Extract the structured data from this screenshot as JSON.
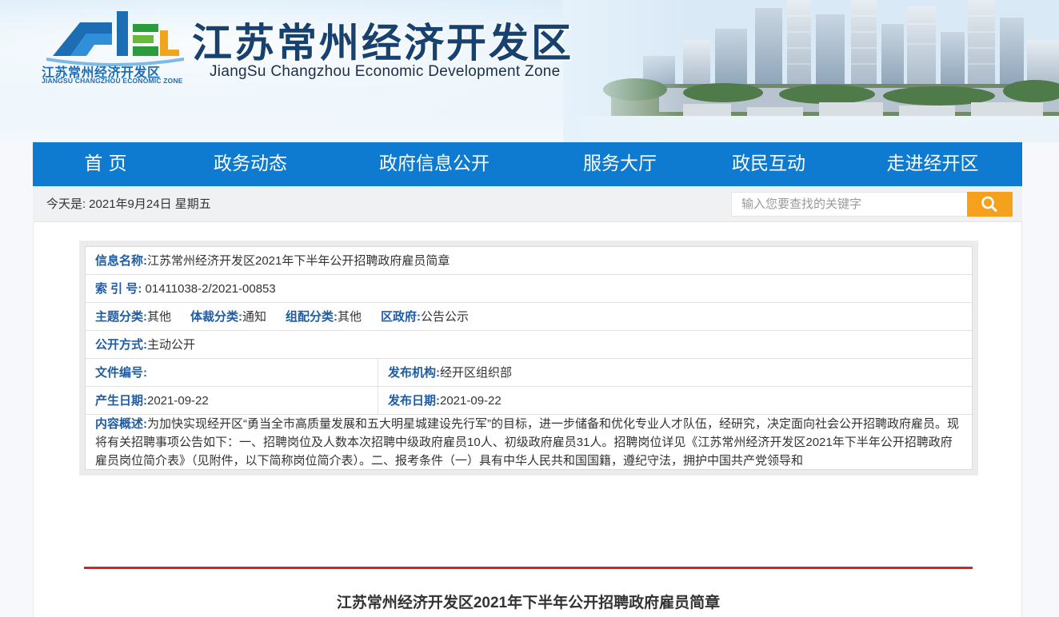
{
  "header": {
    "logo_cn": "江苏常州经济开发区",
    "logo_en": "JIANGSU CHANGZHOU ECONOMIC ZONE",
    "title": "江苏常州经济开发区",
    "subtitle": "JiangSu Changzhou Economic Development Zone"
  },
  "nav": {
    "items": [
      {
        "label": "首 页"
      },
      {
        "label": "政务动态"
      },
      {
        "label": "政府信息公开"
      },
      {
        "label": "服务大厅"
      },
      {
        "label": "政民互动"
      },
      {
        "label": "走进经开区"
      }
    ]
  },
  "infobar": {
    "date_label": "今天是:",
    "date_value": "2021年9月24日 星期五",
    "search_placeholder": "输入您要查找的关键字"
  },
  "meta": {
    "info_name_label": "信息名称:",
    "info_name": "江苏常州经济开发区2021年下半年公开招聘政府雇员简章",
    "index_label": "索 引 号:",
    "index": "01411038-2/2021-00853",
    "topic_label": "主题分类:",
    "topic": "其他",
    "genre_label": "体裁分类:",
    "genre": "通知",
    "group_label": "组配分类:",
    "group": "其他",
    "district_label": "区政府:",
    "district": "公告公示",
    "open_mode_label": "公开方式:",
    "open_mode": "主动公开",
    "doc_no_label": "文件编号:",
    "doc_no": "",
    "publisher_label": "发布机构:",
    "publisher": "经开区组织部",
    "created_label": "产生日期:",
    "created": "2021-09-22",
    "published_label": "发布日期:",
    "published": "2021-09-22",
    "summary_label": "内容概述:",
    "summary": "为加快实现经开区“勇当全市高质量发展和五大明星城建设先行军”的目标，进一步储备和优化专业人才队伍，经研究，决定面向社会公开招聘政府雇员。现将有关招聘事项公告如下：一、招聘岗位及人数本次招聘中级政府雇员10人、初级政府雇员31人。招聘岗位详见《江苏常州经济开发区2021年下半年公开招聘政府雇员岗位简介表》（见附件，以下简称岗位简介表）。二、报考条件（一）具有中华人民共和国国籍，遵纪守法，拥护中国共产党领导和"
  },
  "article": {
    "title": "江苏常州经济开发区2021年下半年公开招聘政府雇员简章"
  },
  "colors": {
    "nav_bg": "#0e7bd0",
    "label_blue": "#1f5ca3",
    "search_button": "#f5a11d",
    "divider_red": "#d4242b",
    "title_dark": "#17416e"
  },
  "icons": {
    "search": "search-icon",
    "logo": "ce-logo-icon"
  }
}
